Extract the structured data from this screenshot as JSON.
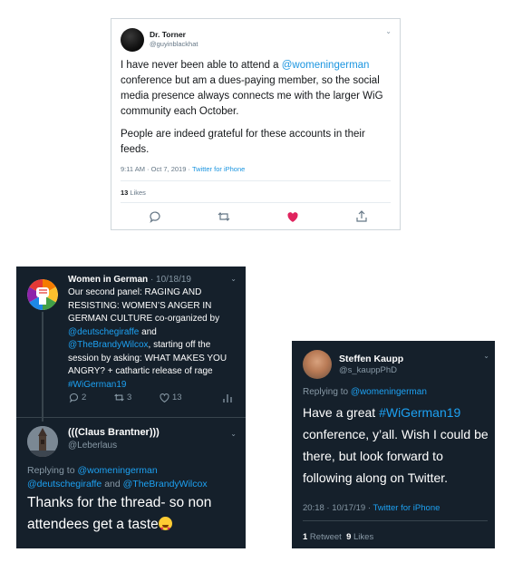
{
  "tweet1": {
    "name": "Dr. Torner",
    "handle": "@guyinblackhat",
    "body_p1_before": "I have never been able to attend a ",
    "body_p1_mention": "@womeningerman",
    "body_p1_after": "\nconference but am a dues-paying member, so the social media presence always connects me with the larger WiG community each October.",
    "body_p2": "People are indeed grateful for these accounts in their feeds.",
    "timestamp": "9:11 AM · Oct 7, 2019 · ",
    "source": "Twitter for iPhone",
    "likes_count": "13",
    "likes_label": " Likes",
    "accent": "#1b95e0",
    "like_color": "#e0245e"
  },
  "tweet2": {
    "name": "Women in German",
    "date": " · 10/18/19",
    "text_1": "Our second panel: RAGING AND RESISTING: WOMEN’S ANGER IN GERMAN CULTURE co-organized by ",
    "mention_1": "@deutschegiraffe",
    "text_2": " and ",
    "mention_2": "@TheBrandyWilcox",
    "text_3": ", starting off the session by asking: WHAT MAKES YOU ANGRY? + cathartic release of rage ",
    "hashtag": "#WiGerman19",
    "reply_count": "2",
    "retweet_count": "3",
    "like_count": "13",
    "background": "#15202b"
  },
  "reply": {
    "name": "(((Claus Brantner)))",
    "handle": "@Leberlaus",
    "replying_label": "Replying to ",
    "replying_to_1": "@womeningerman",
    "replying_to_2": "@deutschegiraffe",
    "replying_and": " and ",
    "replying_to_3": "@TheBrandyWilcox",
    "text": "Thanks for the thread- so non attendees get a taste"
  },
  "tweet3": {
    "name": "Steffen Kaupp",
    "handle": "@s_kauppPhD",
    "replying_label": "Replying to ",
    "replying_to": "@womeningerman",
    "text_before": "Have a great ",
    "hashtag": "#WiGerman19",
    "text_after": " conference, y’all. Wish I could be there, but look forward to following along on Twitter.",
    "timestamp": "20:18 · 10/17/19 · ",
    "source": "Twitter for iPhone",
    "retweet_count": "1",
    "retweet_label": " Retweet  ",
    "like_count": "9",
    "like_label": " Likes"
  }
}
